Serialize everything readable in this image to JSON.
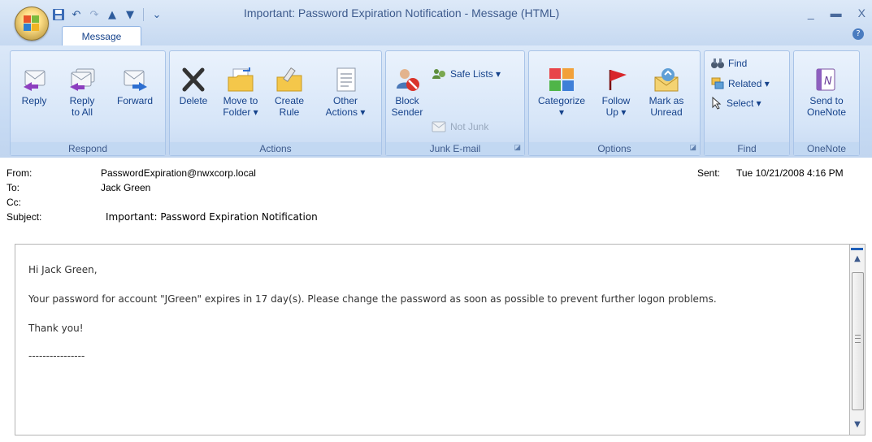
{
  "window": {
    "title": "Important: Password Expiration Notification - Message (HTML)",
    "controls": {
      "minimize": "_",
      "restore": "▬",
      "close": "X"
    }
  },
  "ribbon_tabs": [
    {
      "label": "Message"
    }
  ],
  "ribbon": {
    "groups": [
      {
        "label": "Respond",
        "buttons": [
          "Reply",
          "Reply\nto All",
          "Forward"
        ]
      },
      {
        "label": "Actions",
        "buttons": [
          "Delete",
          "Move to\nFolder ▾",
          "Create\nRule",
          "Other\nActions ▾"
        ]
      },
      {
        "label": "Junk E-mail",
        "buttons": [
          "Block\nSender",
          "Safe Lists ▾",
          "Not Junk"
        ]
      },
      {
        "label": "Options",
        "buttons": [
          "Categorize\n▾",
          "Follow\nUp ▾",
          "Mark as\nUnread"
        ]
      },
      {
        "label": "Find",
        "buttons": [
          "Find",
          "Related ▾",
          "Select ▾"
        ]
      },
      {
        "label": "OneNote",
        "buttons": [
          "Send to\nOneNote"
        ]
      }
    ]
  },
  "message": {
    "from_label": "From:",
    "from": "PasswordExpiration@nwxcorp.local",
    "to_label": "To:",
    "to": "Jack Green",
    "cc_label": "Cc:",
    "cc": "",
    "subject_label": "Subject:",
    "subject": "Important: Password Expiration Notification",
    "sent_label": "Sent:",
    "sent": "Tue 10/21/2008 4:16 PM",
    "body": [
      "Hi Jack Green,",
      "Your password for account \"JGreen\" expires in 17 day(s). Please change the password as soon as possible to prevent further logon problems.",
      "Thank you!",
      "----------------"
    ]
  },
  "icons": {
    "office": "office-orb-icon",
    "save": "save-icon",
    "undo": "undo-icon",
    "redo": "redo-icon",
    "previous": "previous-item-icon",
    "next": "next-item-icon",
    "customize": "customize-qat-icon",
    "help": "help-icon"
  }
}
